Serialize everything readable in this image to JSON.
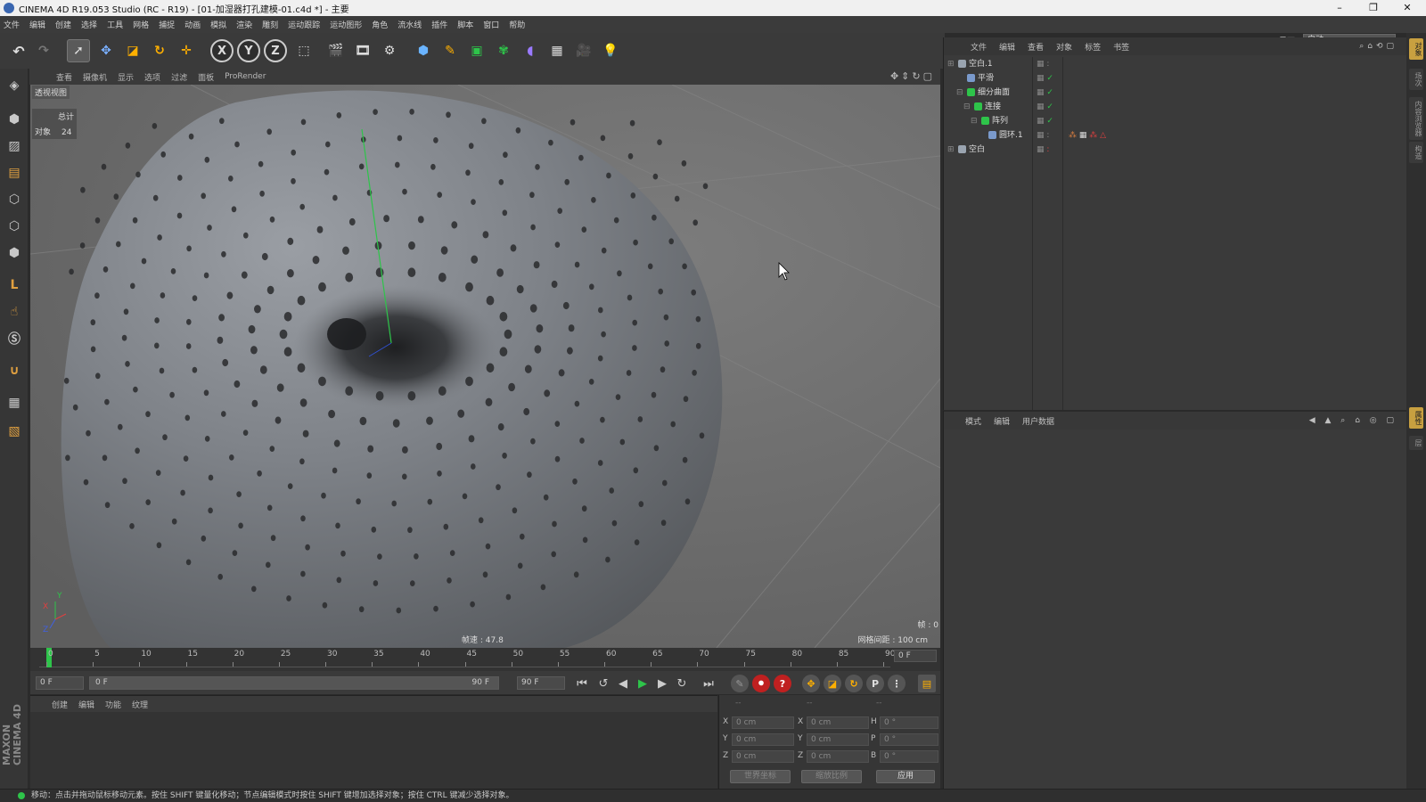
{
  "window": {
    "title": "CINEMA 4D R19.053 Studio (RC - R19) - [01-加湿器打孔建模-01.c4d *] - 主要"
  },
  "menu": [
    "文件",
    "编辑",
    "创建",
    "选择",
    "工具",
    "网格",
    "捕捉",
    "动画",
    "模拟",
    "渲染",
    "雕刻",
    "运动跟踪",
    "运动图形",
    "角色",
    "流水线",
    "插件",
    "脚本",
    "窗口",
    "帮助"
  ],
  "interface": {
    "label": "界面:",
    "value": "启动"
  },
  "viewport": {
    "menu": [
      "查看",
      "摄像机",
      "显示",
      "选项",
      "过滤",
      "面板",
      "ProRender"
    ],
    "label": "透视视图",
    "stats_total_label": "总计",
    "stats_objects_label": "对象",
    "stats_objects_value": "24",
    "fps": "帧速 : 47.8",
    "grid_spacing": "网格间距 : 100 cm",
    "frame_info": "帧 : 0"
  },
  "timeline": {
    "ticks": [
      "0",
      "5",
      "10",
      "15",
      "20",
      "25",
      "30",
      "35",
      "40",
      "45",
      "50",
      "55",
      "60",
      "65",
      "70",
      "75",
      "80",
      "85",
      "90"
    ],
    "current_frame": "0 F"
  },
  "transport": {
    "start": "0 F",
    "range_start": "0 F",
    "range_end": "90 F",
    "end": "90 F"
  },
  "material_panel": {
    "menu": [
      "创建",
      "编辑",
      "功能",
      "纹理"
    ]
  },
  "coordinates": {
    "header": [
      "--",
      "--",
      "--"
    ],
    "rows": [
      {
        "axis": "X",
        "pos": "0 cm",
        "axis2": "X",
        "size": "0 cm",
        "rot_axis": "H",
        "rot": "0 °"
      },
      {
        "axis": "Y",
        "pos": "0 cm",
        "axis2": "Y",
        "size": "0 cm",
        "rot_axis": "P",
        "rot": "0 °"
      },
      {
        "axis": "Z",
        "pos": "0 cm",
        "axis2": "Z",
        "size": "0 cm",
        "rot_axis": "B",
        "rot": "0 °"
      }
    ],
    "mode1": "世界坐标",
    "mode2": "缩放比例",
    "apply": "应用"
  },
  "object_manager": {
    "menu": [
      "文件",
      "编辑",
      "查看",
      "对象",
      "标签",
      "书签"
    ],
    "objects": [
      {
        "name": "空白.1",
        "icon_color": "#9aa4b0",
        "indent": 0
      },
      {
        "name": "平滑",
        "icon_color": "#7a9acc",
        "indent": 1
      },
      {
        "name": "细分曲面",
        "icon_color": "#2ec44a",
        "indent": 1
      },
      {
        "name": "连接",
        "icon_color": "#2ec44a",
        "indent": 2
      },
      {
        "name": "阵列",
        "icon_color": "#2ec44a",
        "indent": 3
      },
      {
        "name": "圆环.1",
        "icon_color": "#7a9acc",
        "indent": 4
      },
      {
        "name": "空白",
        "icon_color": "#9aa4b0",
        "indent": 0
      }
    ]
  },
  "attribute_manager": {
    "menu": [
      "模式",
      "编辑",
      "用户数据"
    ]
  },
  "status": "移动：点击并拖动鼠标移动元素。按住 SHIFT 键量化移动；节点编辑模式时按住 SHIFT 键增加选择对象；按住 CTRL 键减少选择对象。",
  "branding": "MAXON CINEMA 4D",
  "colors": {
    "accent_green": "#2ec44a",
    "viewport_bg": "#6e6e6e",
    "object_gray": "#8a8d92"
  }
}
